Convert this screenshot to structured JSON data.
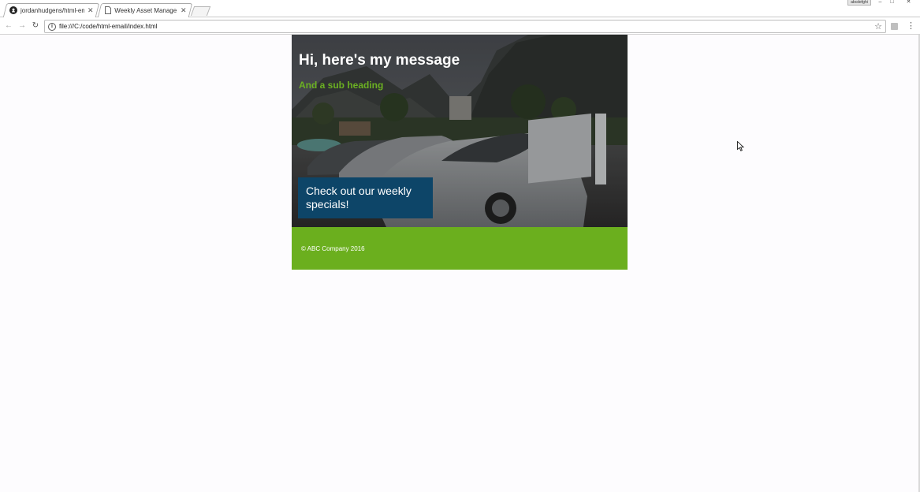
{
  "browser": {
    "tabs": [
      {
        "title": "jordanhudgens/html-em",
        "favicon": "github-icon",
        "active": false
      },
      {
        "title": "Weekly Asset Managem",
        "favicon": "document-icon",
        "active": true
      }
    ],
    "profile_label": "abcdefghi",
    "address": "file:///C:/code/html-email/index.html"
  },
  "email": {
    "title": "Hi, here's my message",
    "subheading": "And a sub heading",
    "cta_label": "Check out our weekly specials!",
    "footer_text": "© ABC Company 2016",
    "colors": {
      "subheading": "#6bb022",
      "cta_background": "#0d4568",
      "footer_background": "#6baf1e"
    }
  }
}
